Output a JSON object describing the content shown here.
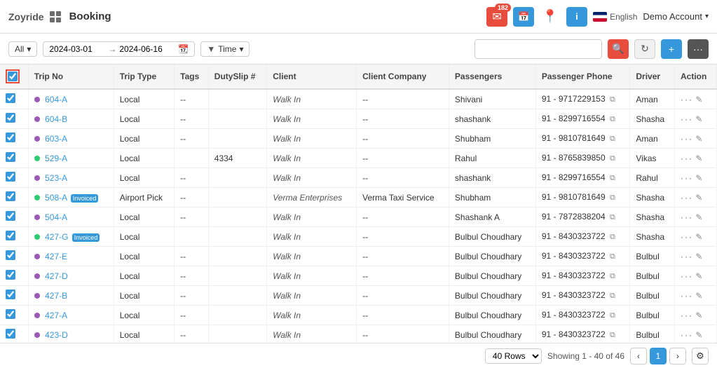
{
  "header": {
    "logo": "Zoyride",
    "title": "Booking",
    "account": "Demo Account",
    "language": "English",
    "notifications": {
      "messages": "182",
      "map": "",
      "info": ""
    }
  },
  "toolbar": {
    "filter_all_label": "All",
    "date_from": "2024-03-01",
    "date_to": "2024-06-16",
    "time_label": "Time",
    "search_placeholder": ""
  },
  "table": {
    "columns": [
      "Trip No",
      "Trip Type",
      "Tags",
      "DutySlip #",
      "Client",
      "Client Company",
      "Passengers",
      "Passenger Phone",
      "Driver",
      "Action"
    ],
    "rows": [
      {
        "checked": true,
        "dot": "purple",
        "trip_no": "604-A",
        "trip_type": "Local",
        "tags": "--",
        "duty_slip": "",
        "client": "Walk In",
        "client_company": "--",
        "passengers": "Shivani",
        "phone": "91 - 9717229153",
        "driver": "Aman"
      },
      {
        "checked": true,
        "dot": "purple",
        "trip_no": "604-B",
        "trip_type": "Local",
        "tags": "--",
        "duty_slip": "",
        "client": "Walk In",
        "client_company": "--",
        "passengers": "shashank",
        "phone": "91 - 8299716554",
        "driver": "Shasha"
      },
      {
        "checked": true,
        "dot": "purple",
        "trip_no": "603-A",
        "trip_type": "Local",
        "tags": "--",
        "duty_slip": "",
        "client": "Walk In",
        "client_company": "--",
        "passengers": "Shubham",
        "phone": "91 - 9810781649",
        "driver": "Aman"
      },
      {
        "checked": true,
        "dot": "green",
        "trip_no": "529-A",
        "trip_type": "Local",
        "tags": "",
        "duty_slip": "4334",
        "client": "Walk In",
        "client_company": "--",
        "passengers": "Rahul",
        "phone": "91 - 8765839850",
        "driver": "Vikas"
      },
      {
        "checked": true,
        "dot": "purple",
        "trip_no": "523-A",
        "trip_type": "Local",
        "tags": "--",
        "duty_slip": "",
        "client": "Walk In",
        "client_company": "--",
        "passengers": "shashank",
        "phone": "91 - 8299716554",
        "driver": "Rahul"
      },
      {
        "checked": true,
        "dot": "green",
        "trip_no": "508-A",
        "trip_type": "Airport Pick",
        "tags": "--",
        "duty_slip": "",
        "client": "Verma Enterprises",
        "client_company": "Verma Taxi Service",
        "passengers": "Shubham",
        "phone": "91 - 9810781649",
        "driver": "Shasha",
        "invoice": true
      },
      {
        "checked": true,
        "dot": "purple",
        "trip_no": "504-A",
        "trip_type": "Local",
        "tags": "--",
        "duty_slip": "",
        "client": "Walk In",
        "client_company": "--",
        "passengers": "Shashank A",
        "phone": "91 - 7872838204",
        "driver": "Shasha"
      },
      {
        "checked": true,
        "dot": "green",
        "trip_no": "427-G",
        "trip_type": "Local",
        "tags": "",
        "duty_slip": "",
        "client": "Walk In",
        "client_company": "--",
        "passengers": "Bulbul Choudhary",
        "phone": "91 - 8430323722",
        "driver": "Shasha",
        "invoice": true
      },
      {
        "checked": true,
        "dot": "purple",
        "trip_no": "427-E",
        "trip_type": "Local",
        "tags": "--",
        "duty_slip": "",
        "client": "Walk In",
        "client_company": "--",
        "passengers": "Bulbul Choudhary",
        "phone": "91 - 8430323722",
        "driver": "Bulbul"
      },
      {
        "checked": true,
        "dot": "purple",
        "trip_no": "427-D",
        "trip_type": "Local",
        "tags": "--",
        "duty_slip": "",
        "client": "Walk In",
        "client_company": "--",
        "passengers": "Bulbul Choudhary",
        "phone": "91 - 8430323722",
        "driver": "Bulbul"
      },
      {
        "checked": true,
        "dot": "purple",
        "trip_no": "427-B",
        "trip_type": "Local",
        "tags": "--",
        "duty_slip": "",
        "client": "Walk In",
        "client_company": "--",
        "passengers": "Bulbul Choudhary",
        "phone": "91 - 8430323722",
        "driver": "Bulbul"
      },
      {
        "checked": true,
        "dot": "purple",
        "trip_no": "427-A",
        "trip_type": "Local",
        "tags": "--",
        "duty_slip": "",
        "client": "Walk In",
        "client_company": "--",
        "passengers": "Bulbul Choudhary",
        "phone": "91 - 8430323722",
        "driver": "Bulbul"
      },
      {
        "checked": true,
        "dot": "purple",
        "trip_no": "423-D",
        "trip_type": "Local",
        "tags": "--",
        "duty_slip": "",
        "client": "Walk In",
        "client_company": "--",
        "passengers": "Bulbul Choudhary",
        "phone": "91 - 8430323722",
        "driver": "Bulbul"
      }
    ]
  },
  "footer": {
    "rows_label": "40 Rows",
    "showing": "Showing 1 - 40 of 46",
    "current_page": "1"
  }
}
